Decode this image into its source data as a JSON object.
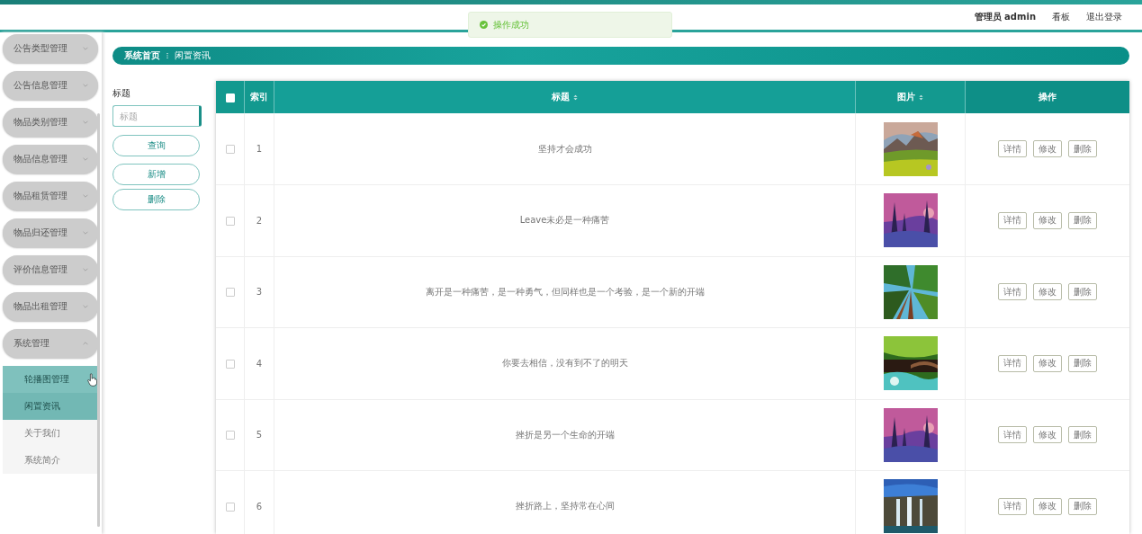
{
  "header": {
    "user": "管理员 admin",
    "links": [
      "看板",
      "退出登录"
    ]
  },
  "toast": {
    "message": "操作成功"
  },
  "sidebar": {
    "items": [
      {
        "label": "公告类型管理",
        "expanded": false
      },
      {
        "label": "公告信息管理",
        "expanded": false
      },
      {
        "label": "物品类别管理",
        "expanded": false
      },
      {
        "label": "物品信息管理",
        "expanded": false
      },
      {
        "label": "物品租赁管理",
        "expanded": false
      },
      {
        "label": "物品归还管理",
        "expanded": false
      },
      {
        "label": "评价信息管理",
        "expanded": false
      },
      {
        "label": "物品出租管理",
        "expanded": false
      },
      {
        "label": "系统管理",
        "expanded": true,
        "children": [
          {
            "label": "轮播图管理",
            "selected": false,
            "hovered": true
          },
          {
            "label": "闲置资讯",
            "selected": true,
            "hovered": false
          },
          {
            "label": "关于我们",
            "selected": false,
            "hovered": false
          },
          {
            "label": "系统简介",
            "selected": false,
            "hovered": false
          }
        ]
      }
    ]
  },
  "breadcrumb": [
    "系统首页",
    "闲置资讯"
  ],
  "search": {
    "label": "标题",
    "placeholder": "标题",
    "buttons": [
      "查询",
      "新增",
      "删除"
    ]
  },
  "table": {
    "select_all": false,
    "columns": [
      {
        "label": "索引",
        "sortable": false
      },
      {
        "label": "标题",
        "sortable": true
      },
      {
        "label": "图片",
        "sortable": true
      },
      {
        "label": "操作",
        "sortable": false
      }
    ],
    "rows": [
      {
        "checked": false,
        "index": "1",
        "title": "坚持才会成功",
        "image": {
          "kind": "picture"
        },
        "actions": [
          "详情",
          "修改",
          "删除"
        ]
      },
      {
        "checked": false,
        "index": "2",
        "title": "Leave未必是一种痛苦",
        "image": {
          "kind": "picture"
        },
        "actions": [
          "详情",
          "修改",
          "删除"
        ]
      },
      {
        "checked": false,
        "index": "3",
        "title": "离开是一种痛苦，是一种勇气，但同样也是一个考验，是一个新的开端",
        "image": {
          "kind": "picture"
        },
        "actions": [
          "详情",
          "修改",
          "删除"
        ]
      },
      {
        "checked": false,
        "index": "4",
        "title": "你要去相信，没有到不了的明天",
        "image": {
          "kind": "picture"
        },
        "actions": [
          "详情",
          "修改",
          "删除"
        ]
      },
      {
        "checked": false,
        "index": "5",
        "title": "挫折是另一个生命的开端",
        "image": {
          "kind": "picture"
        },
        "actions": [
          "详情",
          "修改",
          "删除"
        ]
      },
      {
        "checked": false,
        "index": "6",
        "title": "挫折路上，坚持常在心间",
        "image": {
          "kind": "picture"
        },
        "actions": [
          "详情",
          "修改",
          "删除"
        ]
      }
    ]
  }
}
